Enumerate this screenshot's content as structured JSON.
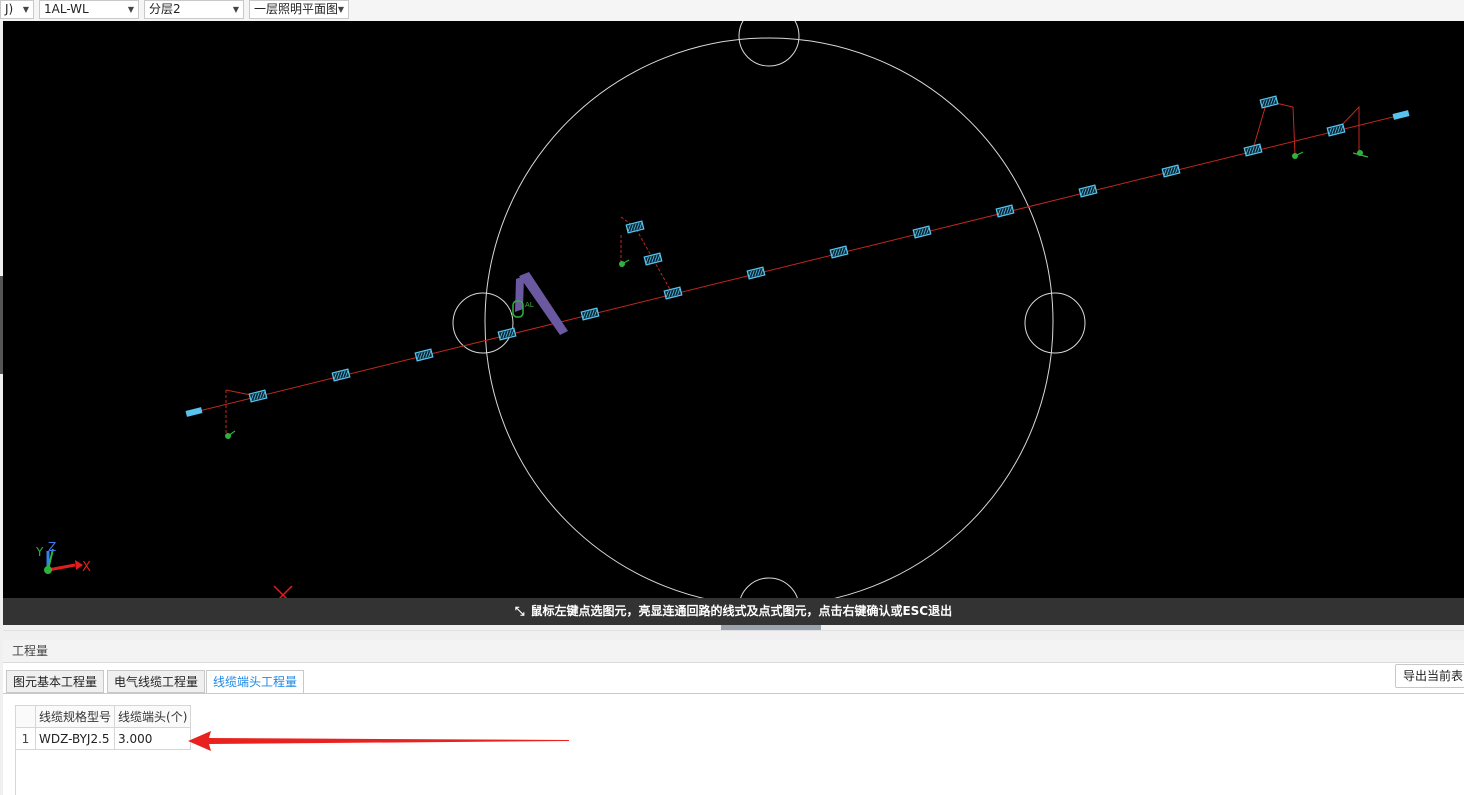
{
  "toolbar": {
    "combo0": "J)",
    "combo1": "1AL-WL",
    "combo2": "分层2",
    "combo3": "一层照明平面图"
  },
  "viewport": {
    "hint": "鼠标左键点选图元，亮显连通回路的线式及点式图元，点击右键确认或ESC退出",
    "axis_x": "X",
    "axis_y": "Y",
    "axis_z": "Z",
    "panel_label": "AL"
  },
  "panel": {
    "title": "工程量",
    "tabs": [
      "图元基本工程量",
      "电气线缆工程量",
      "线缆端头工程量"
    ],
    "active_tab": 2,
    "export_label": "导出当前表",
    "table": {
      "headers": [
        "线缆规格型号",
        "线缆端头(个)"
      ],
      "rows": [
        {
          "index": "1",
          "model": "WDZ-BYJ2.5",
          "count": "3.000"
        }
      ]
    }
  },
  "colors": {
    "wire": "#c0271f",
    "fixture": "#57c3ee",
    "switch": "#2db33a",
    "panel_box": "#6a58a0",
    "circle": "#d9d9d9",
    "annotation_arrow": "#e8231f",
    "active_tab": "#1e88e5"
  }
}
